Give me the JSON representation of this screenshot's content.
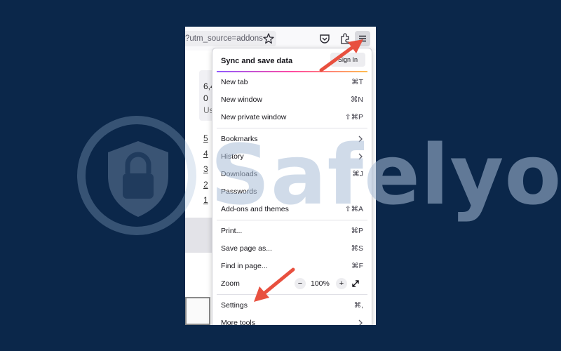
{
  "browser": {
    "url_text": "?utm_source=addons",
    "icons": [
      "star-icon",
      "pocket-icon",
      "extensions-icon",
      "hamburger-menu-icon"
    ]
  },
  "page_background": {
    "stat_lines": [
      "6,4",
      "0",
      "Us"
    ],
    "numbered_links": [
      "5",
      "4",
      "3",
      "2",
      "1"
    ]
  },
  "menu": {
    "sync_title": "Sync and save data",
    "sign_in_label": "Sign In",
    "items": [
      {
        "label": "New tab",
        "shortcut": "⌘T"
      },
      {
        "label": "New window",
        "shortcut": "⌘N"
      },
      {
        "label": "New private window",
        "shortcut": "⇧⌘P"
      },
      {
        "label": "Bookmarks",
        "has_submenu": true
      },
      {
        "label": "History",
        "has_submenu": true
      },
      {
        "label": "Downloads",
        "shortcut": "⌘J"
      },
      {
        "label": "Passwords",
        "shortcut": ""
      },
      {
        "label": "Add-ons and themes",
        "shortcut": "⇧⌘A"
      },
      {
        "label": "Print...",
        "shortcut": "⌘P"
      },
      {
        "label": "Save page as...",
        "shortcut": "⌘S"
      },
      {
        "label": "Find in page...",
        "shortcut": "⌘F"
      },
      {
        "label": "Settings",
        "shortcut": "⌘,"
      },
      {
        "label": "More tools",
        "has_submenu": true
      }
    ],
    "zoom": {
      "label": "Zoom",
      "minus": "−",
      "value": "100%",
      "plus": "+"
    }
  },
  "watermark": {
    "text": "Safelyo"
  },
  "colors": {
    "background": "#0b274a",
    "arrow": "#e8503f",
    "sync_gradient": [
      "#9059ff",
      "#ff4aa2",
      "#ffbd4f"
    ]
  }
}
